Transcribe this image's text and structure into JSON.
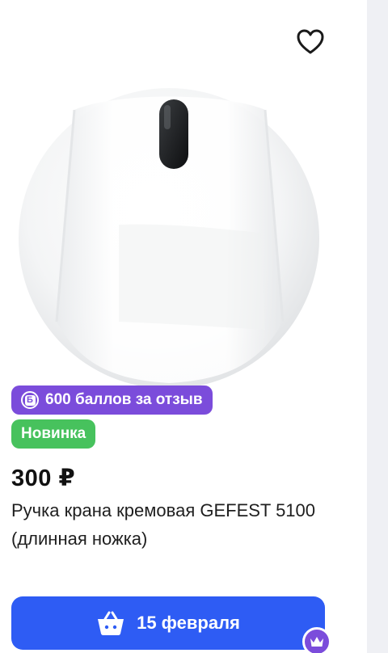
{
  "colors": {
    "points_badge": "#7b4cdb",
    "new_badge": "#47c25d",
    "cart_button": "#2e5cf4",
    "background_strip": "#eff0f4"
  },
  "product": {
    "favorite_icon": "heart-outline-icon",
    "badge_points": {
      "icon": "b-coin-icon",
      "label": "600 баллов за отзыв"
    },
    "badge_new": "Новинка",
    "price": "300 ₽",
    "title": "Ручка крана кремовая GEFEST 5100 (длинная ножка)",
    "cart_button": {
      "icon": "basket-icon",
      "label": "15 февраля"
    },
    "premium_icon": "crown-icon"
  }
}
